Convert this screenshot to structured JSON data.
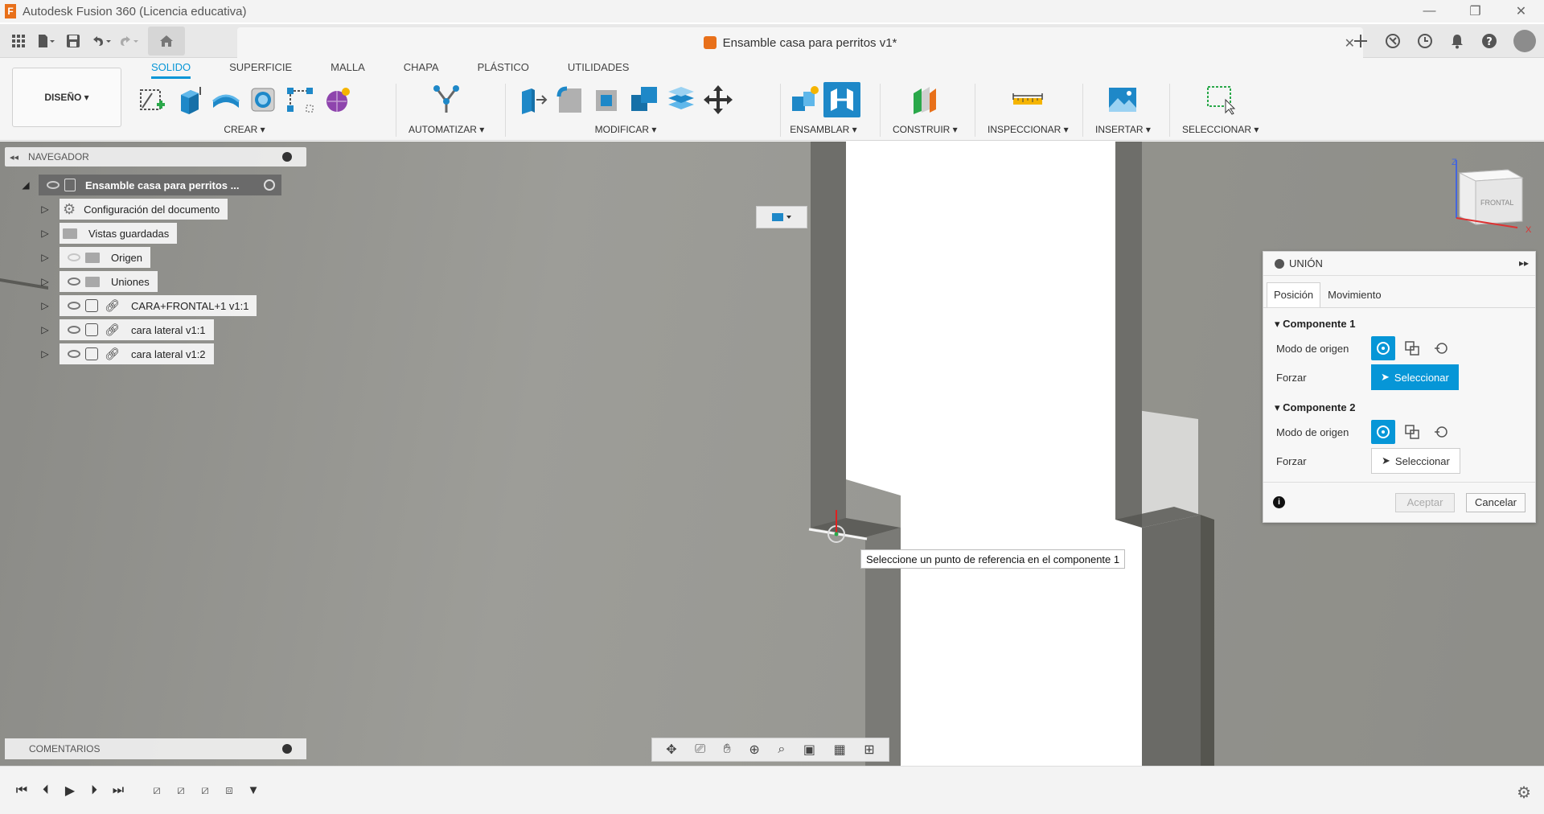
{
  "titlebar": {
    "app_title": "Autodesk Fusion 360 (Licencia educativa)",
    "logo_letter": "F",
    "controls": [
      "—",
      "❐",
      "✕"
    ]
  },
  "document": {
    "title": "Ensamble casa para perritos v1*",
    "close": "✕"
  },
  "toolbar": {
    "design_label": "DISEÑO ▾",
    "tabs": [
      "SOLIDO",
      "SUPERFICIE",
      "MALLA",
      "CHAPA",
      "PLÁSTICO",
      "UTILIDADES"
    ],
    "groups": {
      "crear": "CREAR ▾",
      "automatizar": "AUTOMATIZAR ▾",
      "modificar": "MODIFICAR ▾",
      "ensamblar": "ENSAMBLAR ▾",
      "construir": "CONSTRUIR ▾",
      "inspeccionar": "INSPECCIONAR ▾",
      "insertar": "INSERTAR ▾",
      "seleccionar": "SELECCIONAR ▾"
    }
  },
  "navigator": {
    "header": "NAVEGADOR",
    "root": "Ensamble casa para perritos ...",
    "items": [
      "Configuración del documento",
      "Vistas guardadas",
      "Origen",
      "Uniones",
      "CARA+FRONTAL+1 v1:1",
      "cara lateral v1:1",
      "cara lateral v1:2"
    ]
  },
  "comments": {
    "label": "COMENTARIOS"
  },
  "joint_dialog": {
    "title": "UNIÓN",
    "tabs": [
      "Posición",
      "Movimiento"
    ],
    "section1": "Componente 1",
    "section2": "Componente 2",
    "origin_mode_label": "Modo de origen",
    "snap_label": "Forzar",
    "select_label": "Seleccionar",
    "ok_label": "Aceptar",
    "cancel_label": "Cancelar",
    "info": "i"
  },
  "tooltip": "Seleccione un punto de referencia en el componente 1",
  "viewcube": {
    "face_label": "FRONTAL",
    "axis_z": "Z",
    "axis_x": "X"
  },
  "colors": {
    "accent": "#0696d7",
    "brand": "#e8701a"
  }
}
